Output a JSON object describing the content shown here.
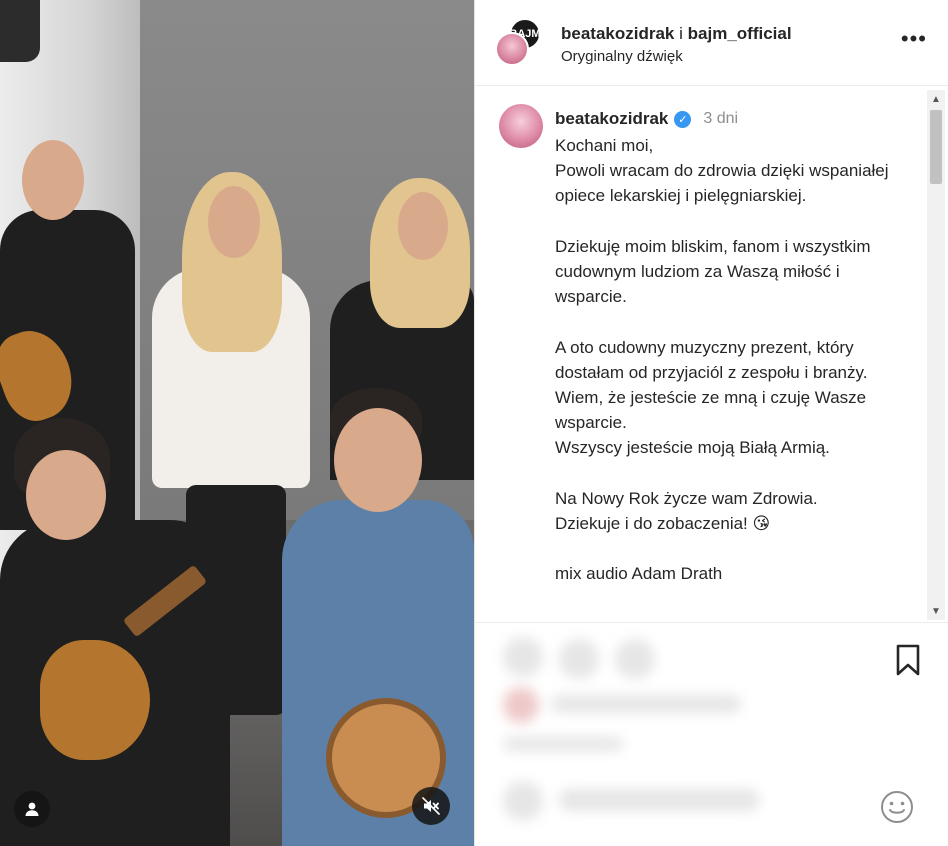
{
  "header": {
    "avatar_initials": "BAJM",
    "user1": "beatakozidrak",
    "separator": "i",
    "user2": "bajm_official",
    "audio": "Oryginalny dźwięk",
    "more": "•••"
  },
  "caption": {
    "username": "beatakozidrak",
    "verified_mark": "✓",
    "time": "3 dni",
    "text": "Kochani moi,\nPowoli wracam do zdrowia dzięki wspaniałej opiece lekarskiej i pielęgniarskiej.\n\nDziekuję moim bliskim, fanom i wszystkim cudownym ludziom za Waszą miłość i wsparcie.\n\nA oto cudowny muzyczny prezent, który dostałam od przyjaciól z zespołu i branży. Wiem, że jesteście ze mną i czuję Wasze wsparcie.\nWszyscy jesteście moją Białą Armią.\n\nNa Nowy Rok życze wam Zdrowia.\nDziekuje i do zobaczenia! 😘\n\nmix audio Adam Drath"
  },
  "scrollbar": {
    "up": "▲",
    "down": "▼"
  },
  "icons": {
    "more": "more-icon",
    "verified": "verified-badge-icon",
    "user": "user-icon",
    "mute": "muted-speaker-icon",
    "bookmark": "bookmark-icon",
    "emoji": "emoji-icon"
  },
  "colors": {
    "verified": "#3897f0",
    "text": "#262626",
    "muted_text": "#8e8e8e"
  }
}
